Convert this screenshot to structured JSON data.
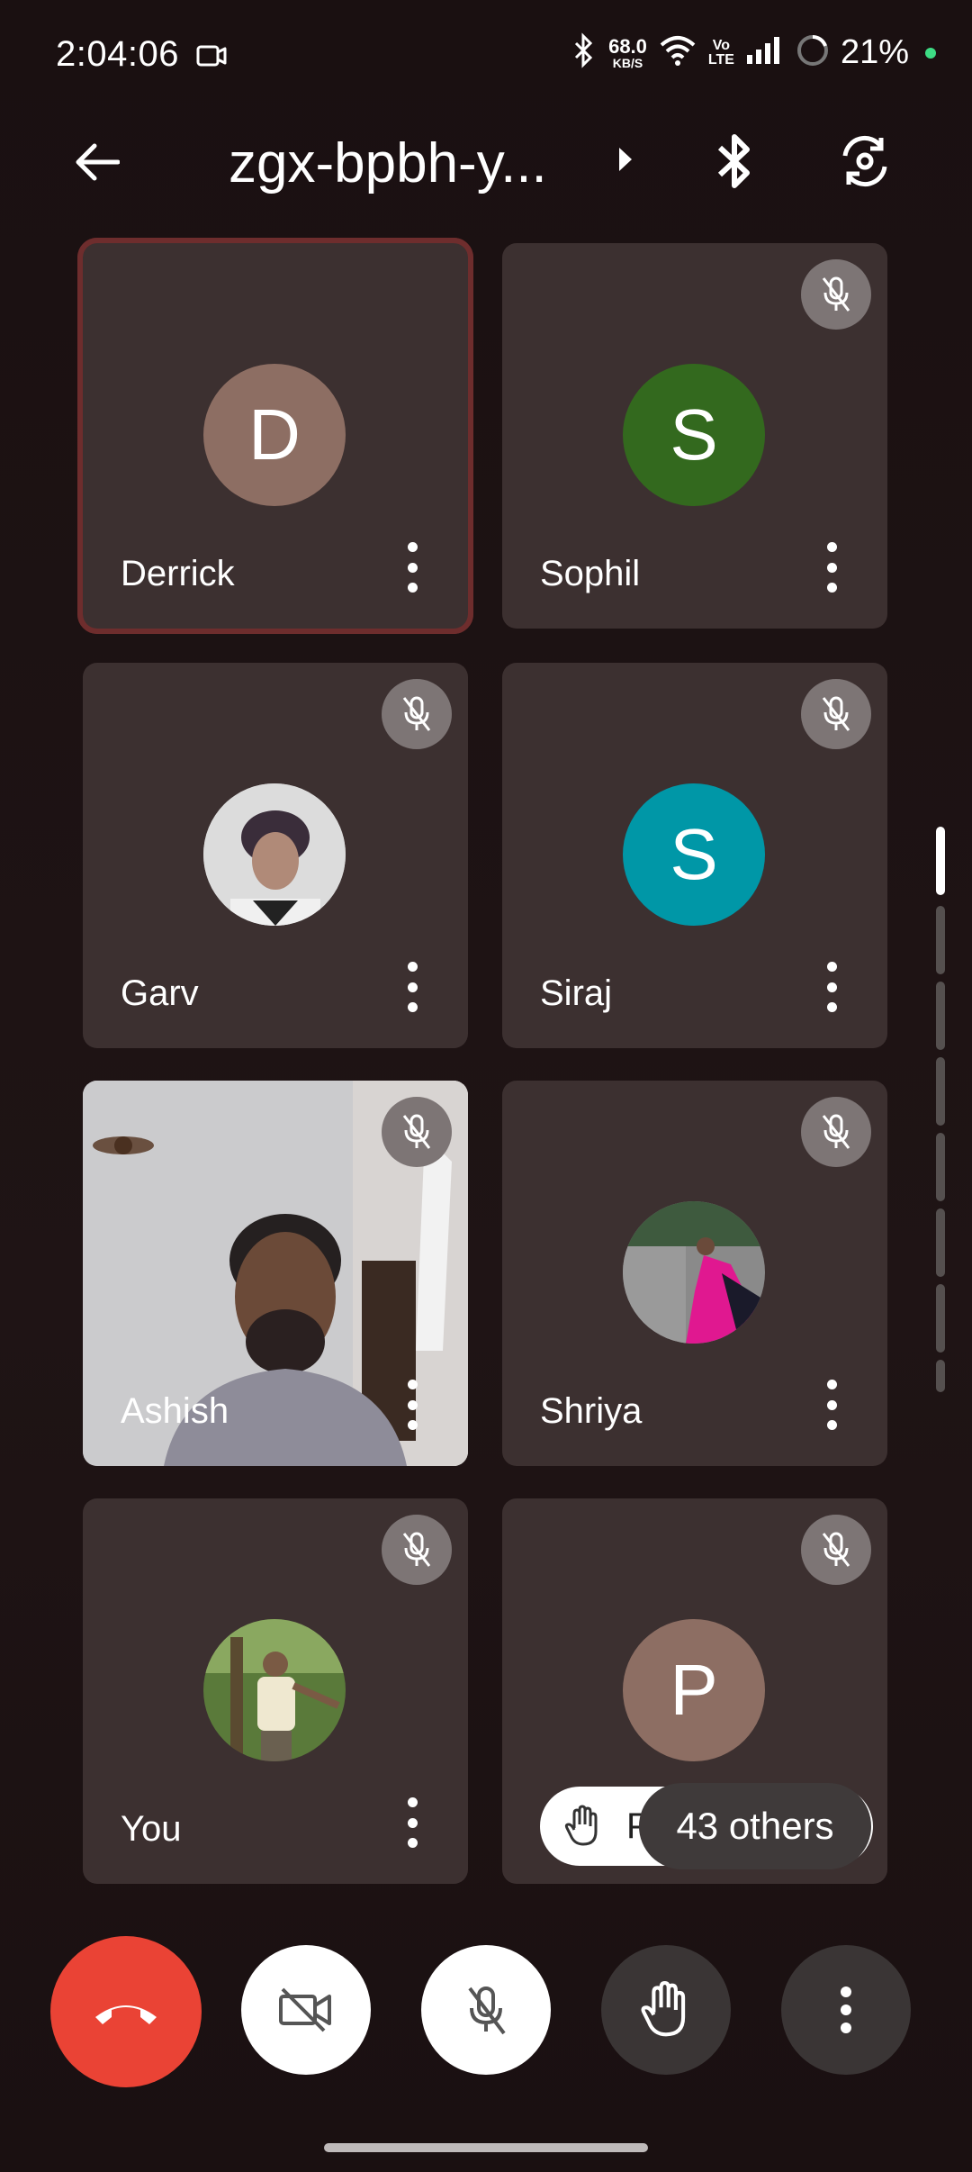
{
  "status_bar": {
    "time": "2:04:06",
    "net_speed_value": "68.0",
    "net_speed_unit": "KB/S",
    "volte_top": "Vo",
    "volte_bottom": "LTE",
    "battery_percent": "21%"
  },
  "header": {
    "meeting_code": "zgx-bpbh-y..."
  },
  "participants": [
    {
      "name": "Derrick",
      "initial": "D",
      "avatar_color": "#8d6e63",
      "muted": false,
      "active_speaker": true
    },
    {
      "name": "Sophil",
      "initial": "S",
      "avatar_color": "#33691e",
      "muted": true
    },
    {
      "name": "Garv",
      "initial": "",
      "avatar_color": "#c8c8c8",
      "muted": true,
      "photo": true
    },
    {
      "name": "Siraj",
      "initial": "S",
      "avatar_color": "#0097a7",
      "muted": true
    },
    {
      "name": "Ashish",
      "muted": true,
      "video": true
    },
    {
      "name": "Shriya",
      "initial": "",
      "avatar_color": "#5a5a5a",
      "muted": true,
      "photo": true
    },
    {
      "name": "You",
      "initial": "",
      "avatar_color": "#4a6a3a",
      "muted": true,
      "photo": true
    },
    {
      "name": "P",
      "initial": "P",
      "avatar_color": "#8d6e63",
      "muted": true
    }
  ],
  "hand_raise": {
    "name_partial": "PR"
  },
  "others": {
    "label": "43 others"
  },
  "colors": {
    "end_call": "#ea4335",
    "tile_bg": "#3c3030",
    "active_border": "#6e2d2d"
  }
}
